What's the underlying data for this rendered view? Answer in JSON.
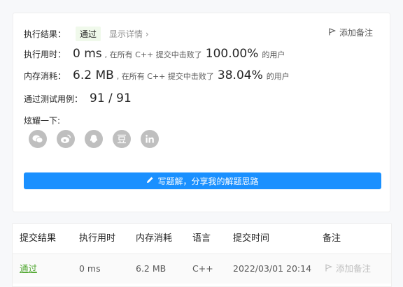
{
  "result": {
    "label": "执行结果：",
    "badge": "通过",
    "detail_link": "显示详情 ›",
    "add_note": "添加备注"
  },
  "runtime": {
    "label": "执行用时：",
    "value": "0 ms",
    "text_before": ", 在所有 C++ 提交中击败了",
    "percent": "100.00%",
    "text_after": "的用户"
  },
  "memory": {
    "label": "内存消耗：",
    "value": "6.2 MB",
    "text_before": ", 在所有 C++ 提交中击败了",
    "percent": "38.04%",
    "text_after": "的用户"
  },
  "testcases": {
    "label": "通过测试用例：",
    "value": "91 / 91"
  },
  "share": {
    "label": "炫耀一下:",
    "icons": [
      "wechat-icon",
      "weibo-icon",
      "qq-icon",
      "douban-icon",
      "linkedin-icon"
    ]
  },
  "solution_button": "写题解，分享我的解题思路",
  "table": {
    "headers": [
      "提交结果",
      "执行用时",
      "内存消耗",
      "语言",
      "提交时间",
      "备注"
    ],
    "rows": [
      {
        "status": "通过",
        "runtime": "0 ms",
        "memory": "6.2 MB",
        "language": "C++",
        "time": "2022/03/01 20:14",
        "note": "添加备注"
      }
    ]
  },
  "colors": {
    "primary": "#1a90ff",
    "success": "#52a832",
    "icon_gray": "#bfbfbf"
  }
}
